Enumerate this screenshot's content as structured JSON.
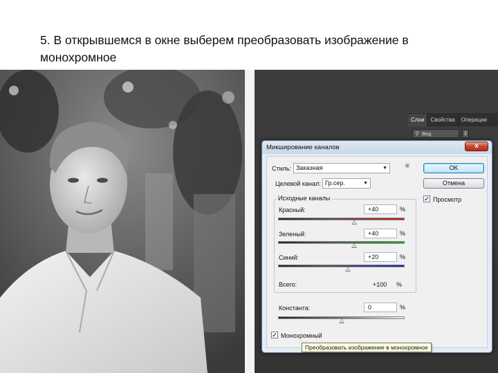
{
  "slide": {
    "caption": "5. В открывшемся в окне выберем преобразовать изображение в монохромное"
  },
  "layers_panel": {
    "tabs": [
      "Слои",
      "Свойства",
      "Операции"
    ],
    "search_label": "Вид",
    "search_icon": "search-icon"
  },
  "dialog": {
    "title": "Микширование каналов",
    "close_label": "x",
    "style_label": "Стиль:",
    "style_value": "Заказная",
    "target_label": "Целевой канал:",
    "target_value": "Гр.сер.",
    "source_group_label": "Исходные каналы",
    "channels": [
      {
        "label": "Красный:",
        "value": "+40",
        "unit": "%",
        "level": 40,
        "color": "#d01818"
      },
      {
        "label": "Зеленый:",
        "value": "+40",
        "unit": "%",
        "level": 40,
        "color": "#1fa81f"
      },
      {
        "label": "Синий:",
        "value": "+20",
        "unit": "%",
        "level": 20,
        "color": "#1c1cc8"
      }
    ],
    "total_label": "Всего:",
    "total_value": "+100",
    "total_unit": "%",
    "constant_label": "Константа:",
    "constant_value": "0",
    "constant_unit": "%",
    "constant_level": 0,
    "mono_label": "Монохромный",
    "mono_checked": true,
    "ok_label": "OK",
    "cancel_label": "Отмена",
    "preview_label": "Просмотр",
    "preview_checked": true
  },
  "tooltip": "Преобразовать изображение в монохромное"
}
